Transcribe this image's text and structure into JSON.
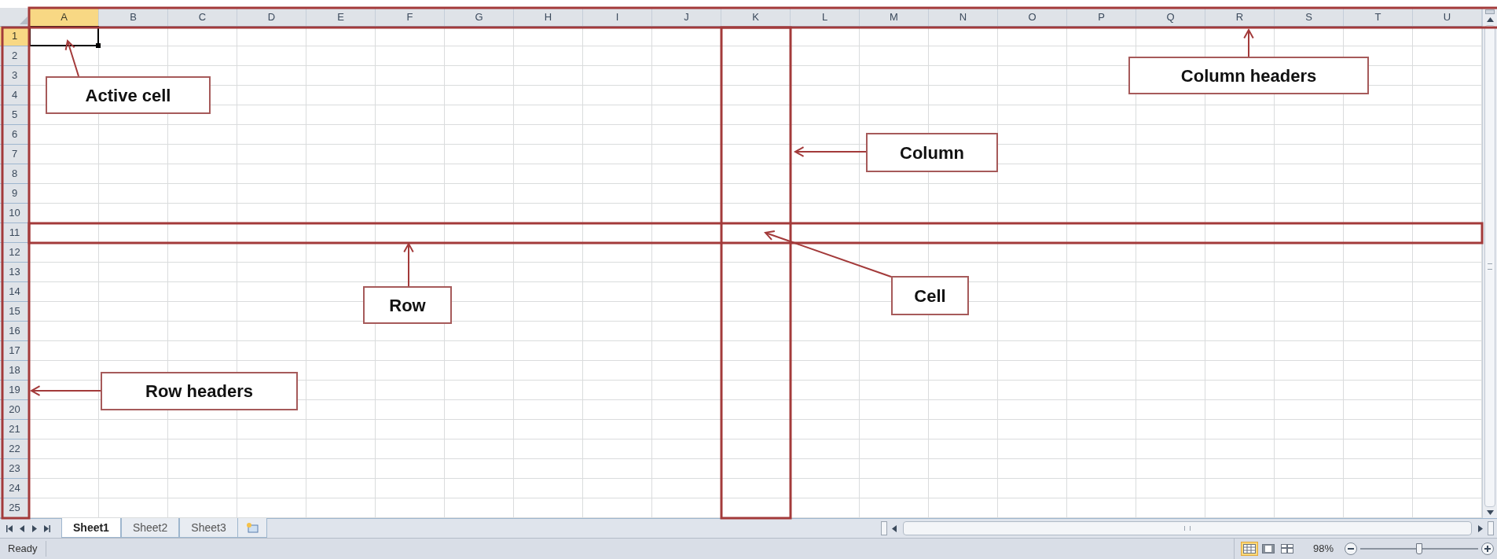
{
  "columns": [
    {
      "label": "A",
      "selected": true
    },
    {
      "label": "B",
      "selected": false
    },
    {
      "label": "C",
      "selected": false
    },
    {
      "label": "D",
      "selected": false
    },
    {
      "label": "E",
      "selected": false
    },
    {
      "label": "F",
      "selected": false
    },
    {
      "label": "G",
      "selected": false
    },
    {
      "label": "H",
      "selected": false
    },
    {
      "label": "I",
      "selected": false
    },
    {
      "label": "J",
      "selected": false
    },
    {
      "label": "K",
      "selected": false
    },
    {
      "label": "L",
      "selected": false
    },
    {
      "label": "M",
      "selected": false
    },
    {
      "label": "N",
      "selected": false
    },
    {
      "label": "O",
      "selected": false
    },
    {
      "label": "P",
      "selected": false
    },
    {
      "label": "Q",
      "selected": false
    },
    {
      "label": "R",
      "selected": false
    },
    {
      "label": "S",
      "selected": false
    },
    {
      "label": "T",
      "selected": false
    },
    {
      "label": "U",
      "selected": false
    }
  ],
  "rows": [
    {
      "label": "1",
      "selected": true
    },
    {
      "label": "2",
      "selected": false
    },
    {
      "label": "3",
      "selected": false
    },
    {
      "label": "4",
      "selected": false
    },
    {
      "label": "5",
      "selected": false
    },
    {
      "label": "6",
      "selected": false
    },
    {
      "label": "7",
      "selected": false
    },
    {
      "label": "8",
      "selected": false
    },
    {
      "label": "9",
      "selected": false
    },
    {
      "label": "10",
      "selected": false
    },
    {
      "label": "11",
      "selected": false
    },
    {
      "label": "12",
      "selected": false
    },
    {
      "label": "13",
      "selected": false
    },
    {
      "label": "14",
      "selected": false
    },
    {
      "label": "15",
      "selected": false
    },
    {
      "label": "16",
      "selected": false
    },
    {
      "label": "17",
      "selected": false
    },
    {
      "label": "18",
      "selected": false
    },
    {
      "label": "19",
      "selected": false
    },
    {
      "label": "20",
      "selected": false
    },
    {
      "label": "21",
      "selected": false
    },
    {
      "label": "22",
      "selected": false
    },
    {
      "label": "23",
      "selected": false
    },
    {
      "label": "24",
      "selected": false
    },
    {
      "label": "25",
      "selected": false
    }
  ],
  "sheets": [
    {
      "label": "Sheet1",
      "selected": true
    },
    {
      "label": "Sheet2",
      "selected": false
    },
    {
      "label": "Sheet3",
      "selected": false
    }
  ],
  "status_bar": {
    "status": "Ready",
    "views": [
      {
        "kind": "normal",
        "selected": true
      },
      {
        "kind": "page-layout",
        "selected": false
      },
      {
        "kind": "page-break",
        "selected": false
      }
    ],
    "zoom": "98%",
    "zoom_slider": {
      "level": 0.5
    }
  },
  "annotations": [
    {
      "label": "Active cell"
    },
    {
      "label": "Column headers"
    },
    {
      "label": "Column"
    },
    {
      "label": "Cell"
    },
    {
      "label": "Row"
    },
    {
      "label": "Row headers"
    }
  ]
}
